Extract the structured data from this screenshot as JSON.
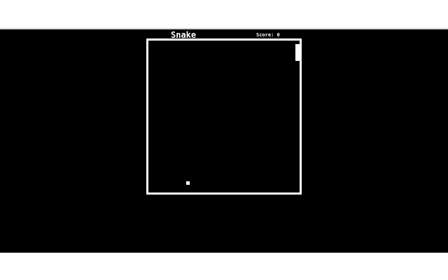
{
  "game": {
    "title": "Snake",
    "score_label": "Score: 0",
    "score_value": 0
  },
  "colors": {
    "background": "#000000",
    "foreground": "#ffffff",
    "page_margin": "#ffffff"
  }
}
